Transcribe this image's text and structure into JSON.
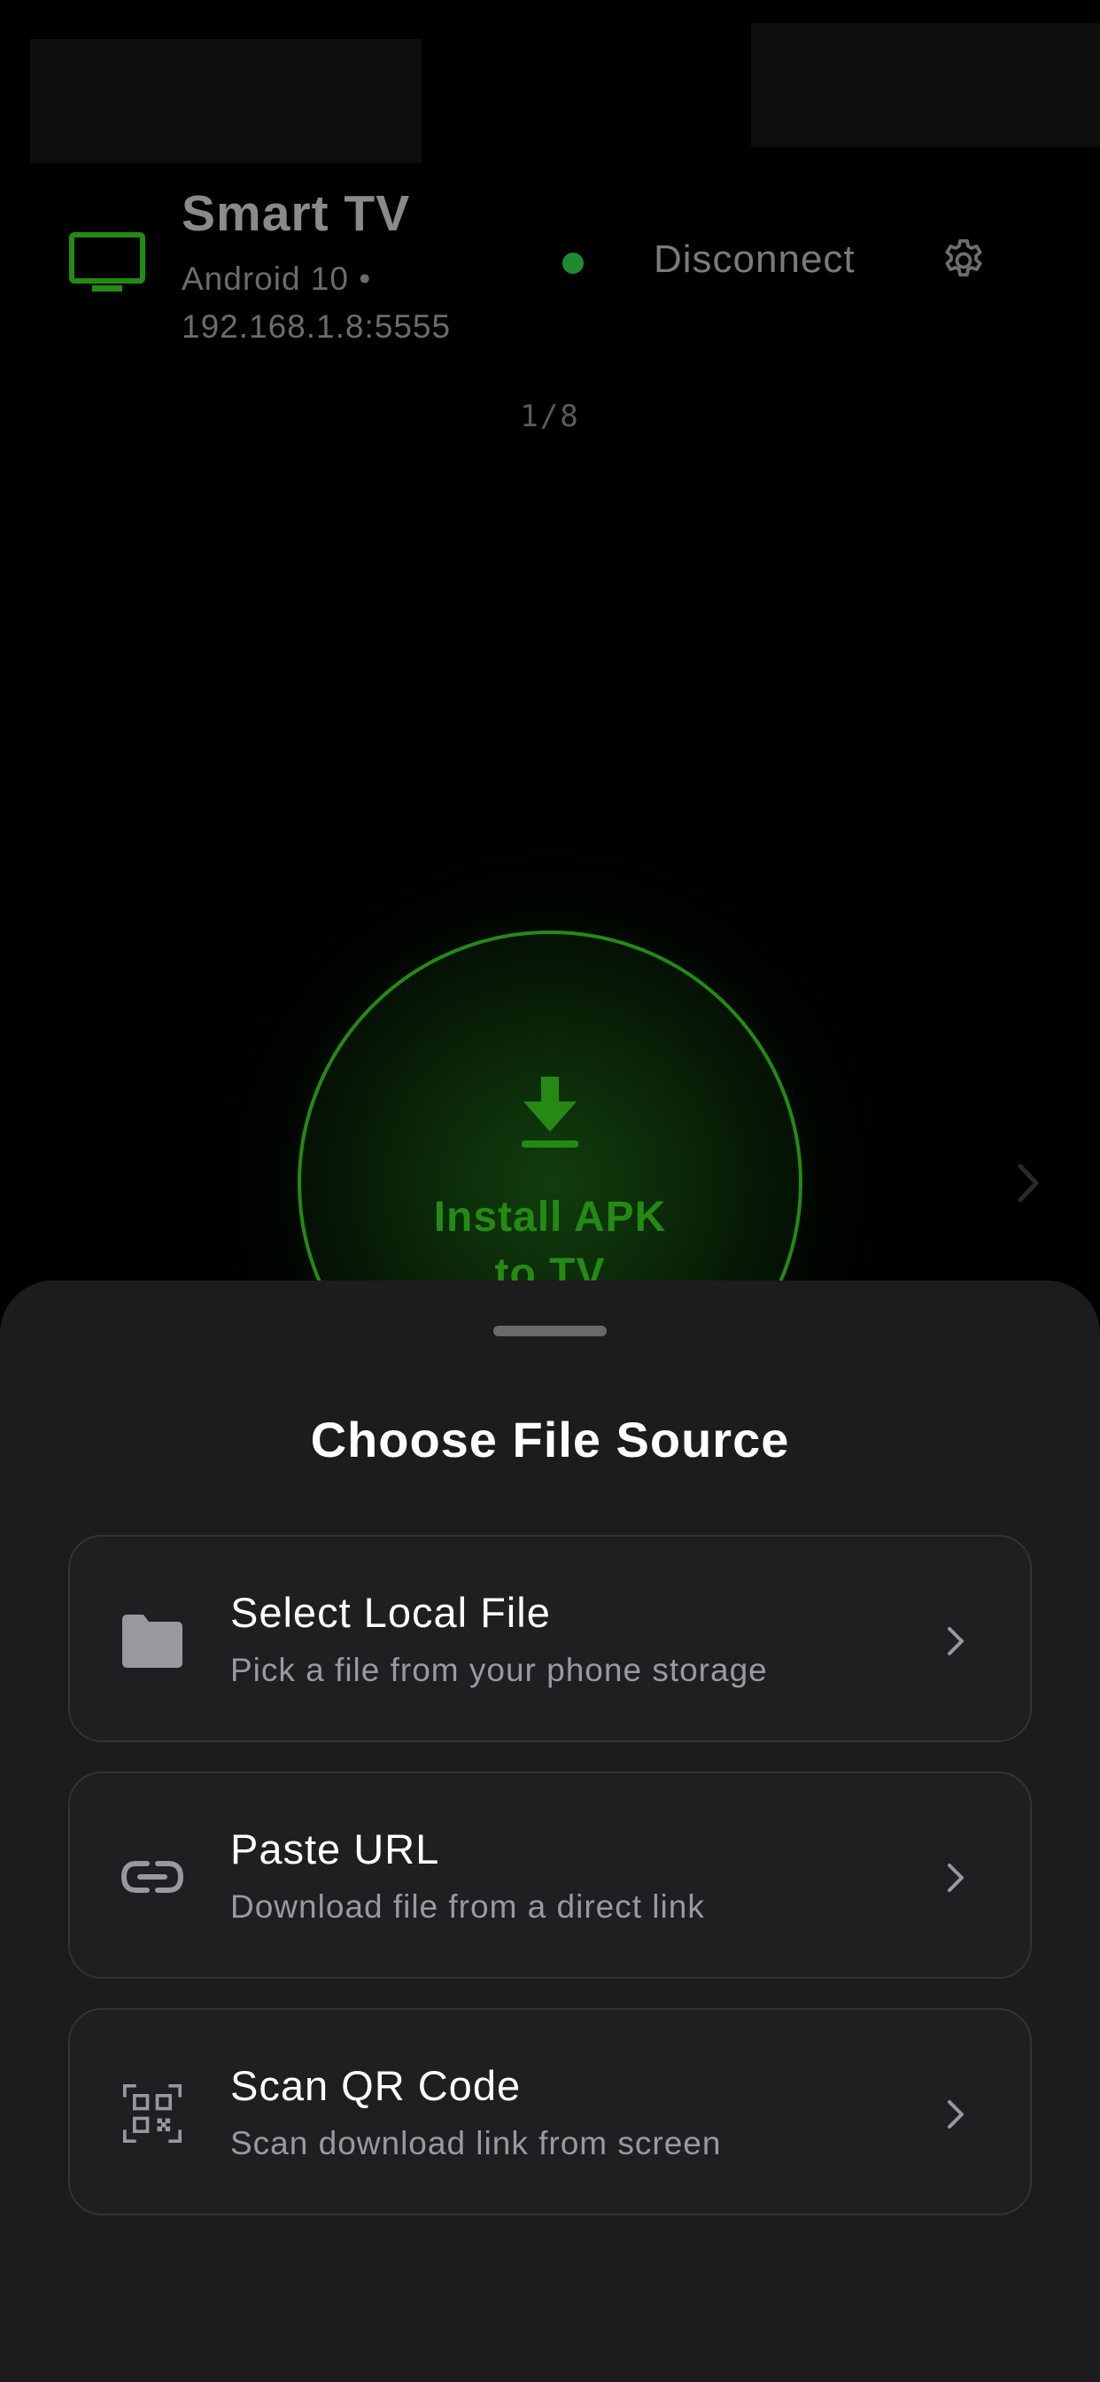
{
  "device": {
    "name": "Smart TV",
    "info_line1": "Android 10 •",
    "info_line2": "192.168.1.8:5555",
    "status": "connected",
    "disconnect_label": "Disconnect"
  },
  "pager": {
    "text": "1/8"
  },
  "install": {
    "line1": "Install APK",
    "line2": "to TV"
  },
  "sheet": {
    "title": "Choose File Source",
    "options": [
      {
        "icon": "folder-icon",
        "title": "Select Local File",
        "subtitle": "Pick a file from your phone storage"
      },
      {
        "icon": "link-icon",
        "title": "Paste URL",
        "subtitle": "Download file from a direct link"
      },
      {
        "icon": "qr-code-icon",
        "title": "Scan QR Code",
        "subtitle": "Scan download link from screen"
      }
    ]
  },
  "colors": {
    "accent_green": "#248A14",
    "status_green": "#1F8A2E",
    "sheet_bg": "#1C1C1E",
    "card_border": "#333336"
  }
}
